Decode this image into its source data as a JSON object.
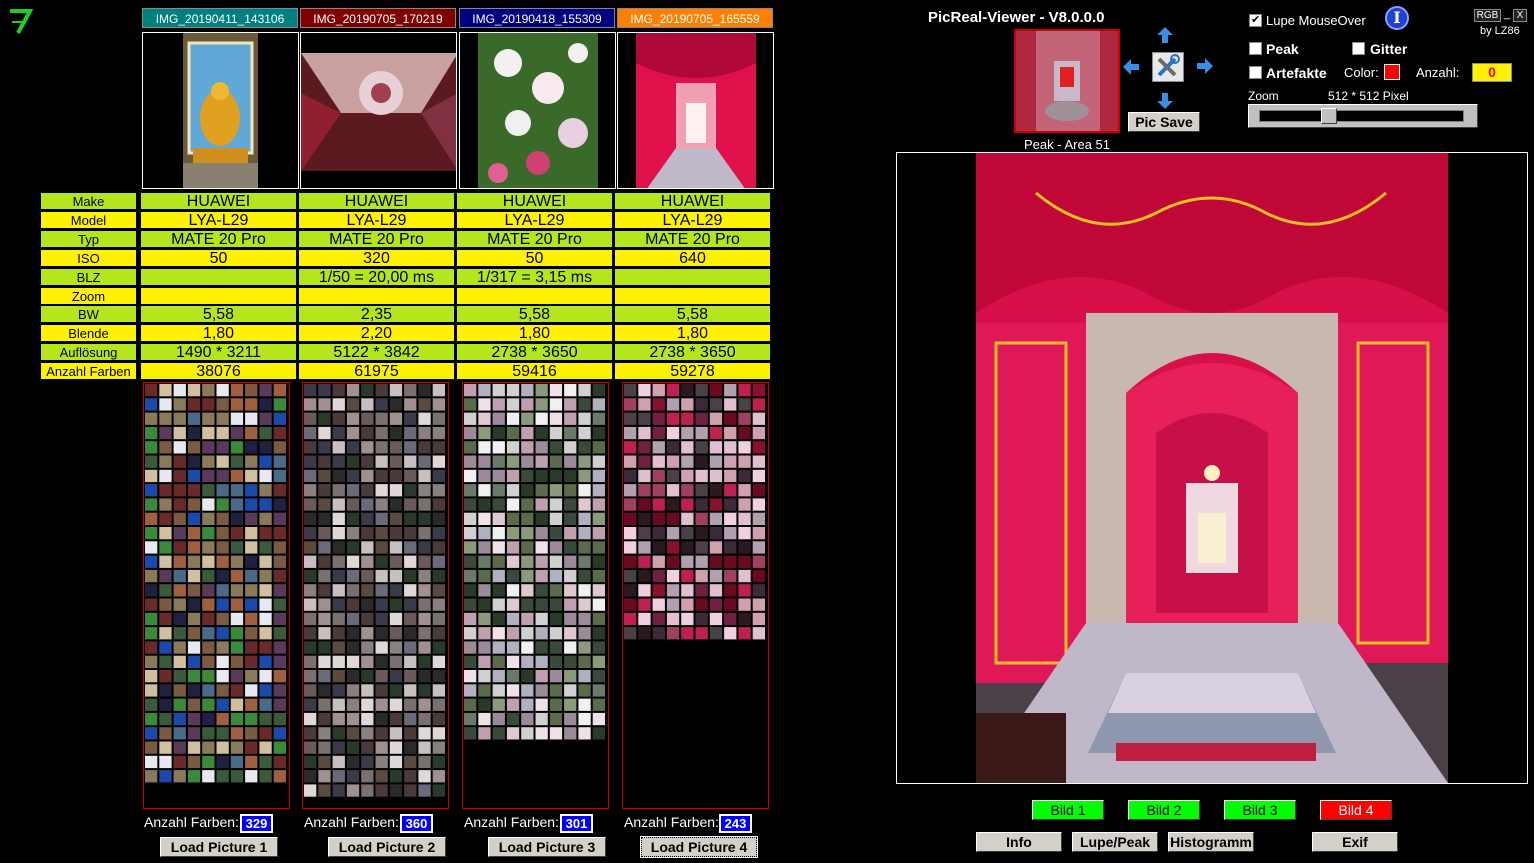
{
  "app": {
    "title": "PicReal-Viewer - V8.0.0.0",
    "by": "by LZ86",
    "window_controls": {
      "rgb": "RGB",
      "min": "_",
      "close": "X"
    }
  },
  "files": [
    {
      "name": "IMG_20190411_143106",
      "color": "#008080"
    },
    {
      "name": "IMG_20190705_170219",
      "color": "#800000"
    },
    {
      "name": "IMG_20190418_155309",
      "color": "#000080"
    },
    {
      "name": "IMG_20190705_165559",
      "color": "#ff8000"
    }
  ],
  "exif_labels": [
    "Make",
    "Model",
    "Typ",
    "ISO",
    "BLZ",
    "Zoom",
    "BW",
    "Blende",
    "Auflösung",
    "Anzahl Farben"
  ],
  "exif": [
    {
      "make": "HUAWEI",
      "model": "LYA-L29",
      "typ": "MATE 20 Pro",
      "iso": "50",
      "blz": "",
      "zoom": "",
      "bw": "5,58",
      "blende": "1,80",
      "aufloesung": "1490 * 3211",
      "farben": "38076"
    },
    {
      "make": "HUAWEI",
      "model": "LYA-L29",
      "typ": "MATE 20 Pro",
      "iso": "320",
      "blz": "1/50 = 20,00 ms",
      "zoom": "",
      "bw": "2,35",
      "blende": "2,20",
      "aufloesung": "5122 * 3842",
      "farben": "61975"
    },
    {
      "make": "HUAWEI",
      "model": "LYA-L29",
      "typ": "MATE 20 Pro",
      "iso": "50",
      "blz": "1/317 = 3,15 ms",
      "zoom": "",
      "bw": "5,58",
      "blende": "1,80",
      "aufloesung": "2738 * 3650",
      "farben": "59416"
    },
    {
      "make": "HUAWEI",
      "model": "LYA-L29",
      "typ": "MATE 20 Pro",
      "iso": "640",
      "blz": "",
      "zoom": "",
      "bw": "5,58",
      "blende": "1,80",
      "aufloesung": "2738 * 3650",
      "farben": "59278"
    }
  ],
  "color_panels": [
    {
      "label": "Anzahl Farben:",
      "count": "329",
      "button": "Load Picture 1"
    },
    {
      "label": "Anzahl Farben:",
      "count": "360",
      "button": "Load Picture 2"
    },
    {
      "label": "Anzahl Farben:",
      "count": "301",
      "button": "Load Picture 3"
    },
    {
      "label": "Anzahl Farben:",
      "count": "243",
      "button": "Load Picture 4"
    }
  ],
  "viewer": {
    "pic_save": "Pic Save",
    "peak_caption": "Peak - Area 51",
    "lupe_mouseover": {
      "label": "Lupe MouseOver",
      "checked": true
    },
    "peak": {
      "label": "Peak",
      "checked": false
    },
    "gitter": {
      "label": "Gitter",
      "checked": false
    },
    "artefakte": {
      "label": "Artefakte",
      "checked": false
    },
    "color_label": "Color:",
    "color_value": "#ff0000",
    "anzahl_label": "Anzahl:",
    "anzahl_value": "0",
    "zoom_label": "Zoom",
    "zoom_size": "512 * 512 Pixel",
    "zoom_level": 0.3
  },
  "bild_buttons": [
    {
      "label": "Bild 1",
      "color": "#00ff00"
    },
    {
      "label": "Bild 2",
      "color": "#00ff00"
    },
    {
      "label": "Bild 3",
      "color": "#00ff00"
    },
    {
      "label": "Bild 4",
      "color": "#ff0000"
    }
  ],
  "bottom_buttons": [
    "Info",
    "Lupe/Peak",
    "Histogramm",
    "Exif"
  ]
}
